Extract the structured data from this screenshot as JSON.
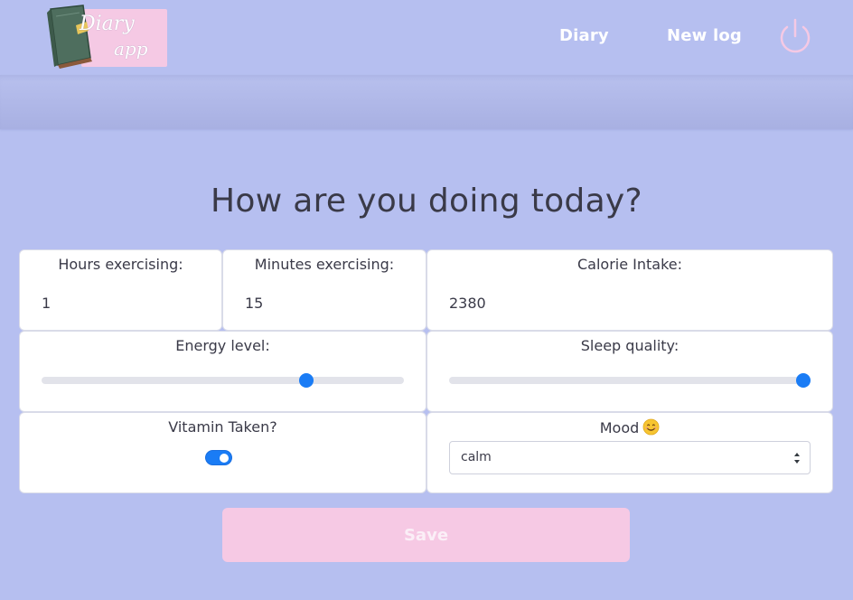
{
  "brand": {
    "line1": "Diary",
    "line2": "app"
  },
  "nav": {
    "diary": "Diary",
    "new_log": "New log"
  },
  "heading": "How are you doing today?",
  "form": {
    "hours_label": "Hours exercising:",
    "hours_value": "1",
    "minutes_label": "Minutes exercising:",
    "minutes_value": "15",
    "calories_label": "Calorie Intake:",
    "calories_value": "2380",
    "energy_label": "Energy level:",
    "energy_level": 0.74,
    "sleep_label": "Sleep quality:",
    "sleep_level": 1.0,
    "vitamin_label": "Vitamin Taken?",
    "vitamin_taken": true,
    "mood_label": "Mood",
    "mood_value": "calm",
    "save_label": "Save"
  },
  "colors": {
    "background": "#b6bff0",
    "accent": "#1a7cf5",
    "pink": "#f6c9e4"
  },
  "icons": [
    "power-icon",
    "diary-book-icon",
    "smiling-face-icon",
    "select-arrows-icon"
  ]
}
